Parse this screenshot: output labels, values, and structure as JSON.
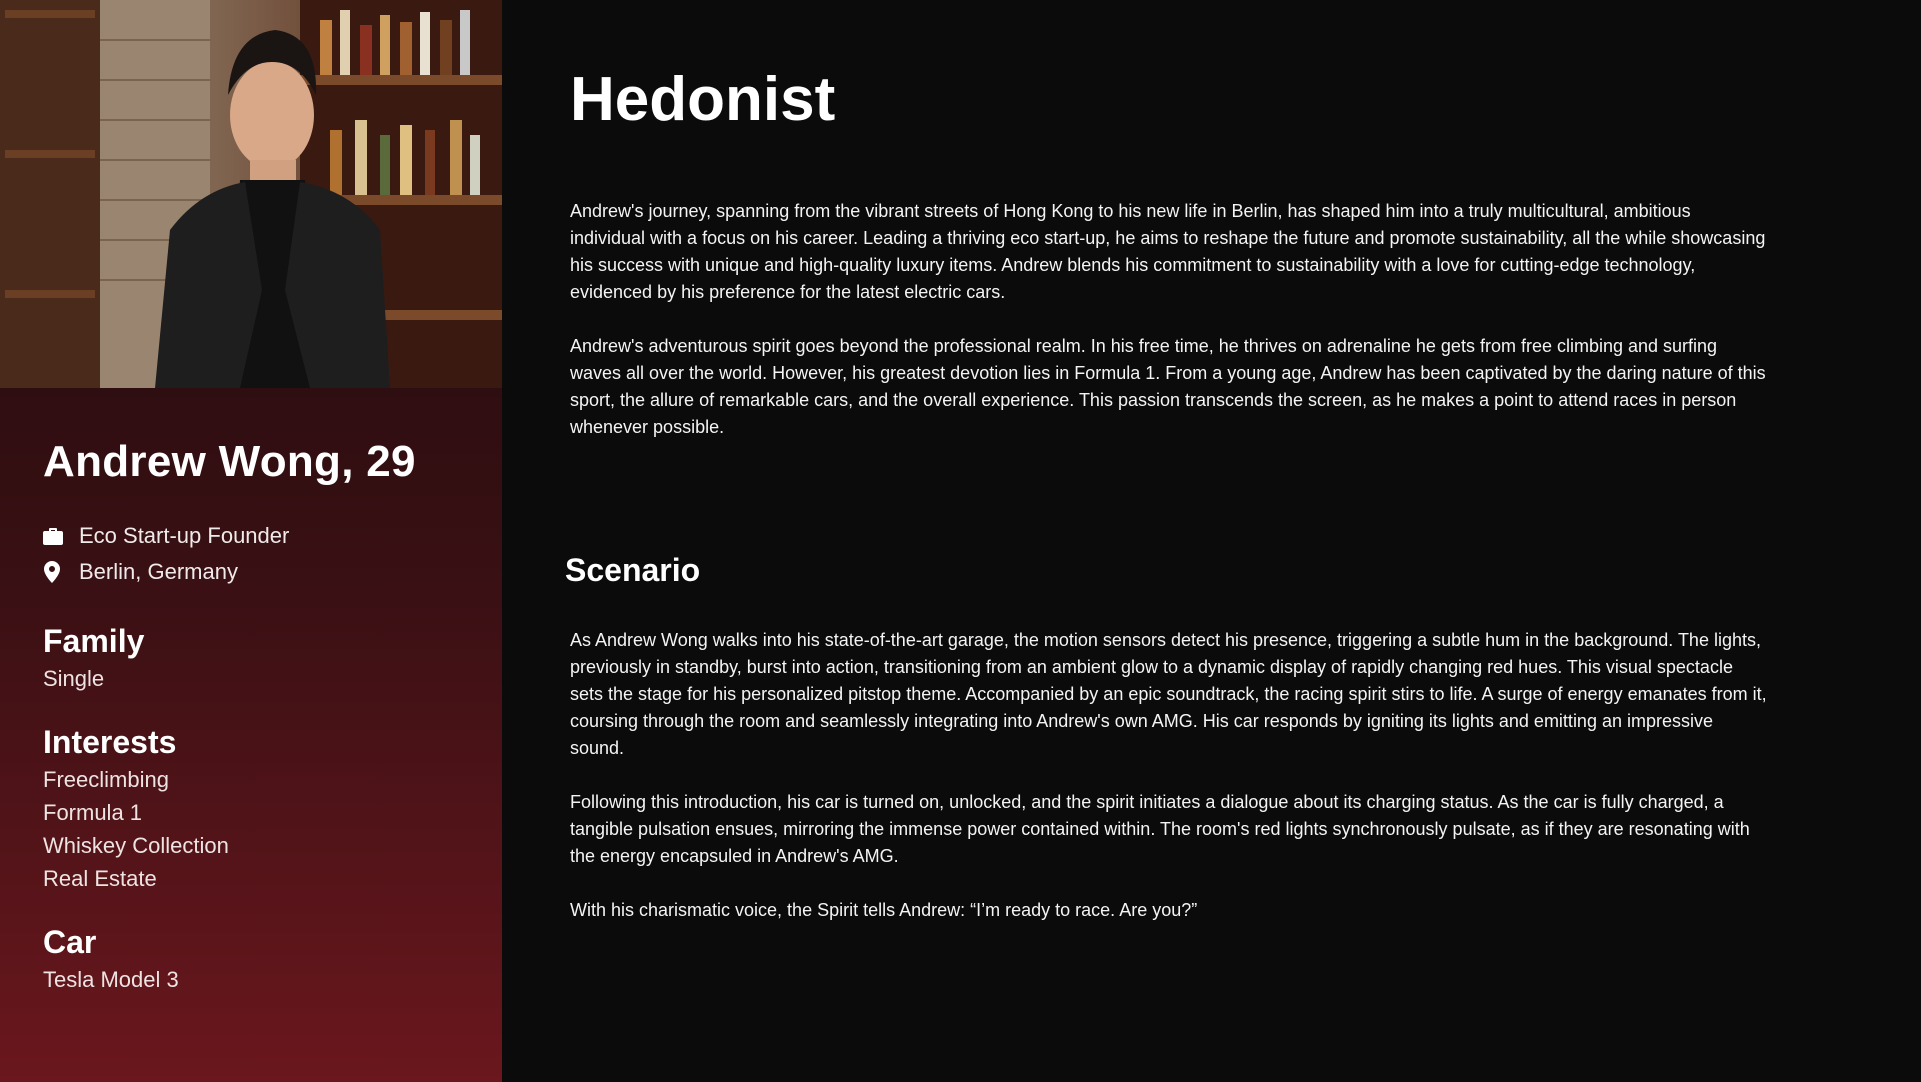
{
  "profile": {
    "name": "Andrew Wong, 29",
    "occupation": "Eco Start-up Founder",
    "location": "Berlin, Germany",
    "family": {
      "title": "Family",
      "value": "Single"
    },
    "interests": {
      "title": "Interests",
      "items": [
        "Freeclimbing",
        "Formula 1",
        "Whiskey Collection",
        "Real Estate"
      ]
    },
    "car": {
      "title": "Car",
      "value": "Tesla Model 3"
    }
  },
  "main": {
    "title": "Hedonist",
    "paragraphs": [
      "Andrew's journey, spanning from the vibrant streets of Hong Kong to his new life in Berlin, has shaped him into a truly multicultural, ambitious individual with a focus on his career. Leading a thriving eco start-up, he aims to reshape the future and promote sustainability, all the while showcasing his success with unique and high-quality luxury items. Andrew blends his commitment to sustainability with a love for cutting-edge technology, evidenced by his preference for the latest electric cars.",
      "Andrew's adventurous spirit goes beyond the professional realm. In his free time, he thrives on adrenaline he gets from free climbing and surfing waves all over the world. However, his greatest devotion lies in Formula 1. From a young age, Andrew has been captivated by the daring nature of this sport, the allure of remarkable cars, and the overall experience. This passion transcends the screen, as he makes a point to attend races in person whenever possible."
    ]
  },
  "scenario": {
    "title": "Scenario",
    "paragraphs": [
      "As Andrew Wong walks into his state-of-the-art garage, the motion sensors detect his presence, triggering a subtle hum in the background. The lights, previously in standby, burst into action, transitioning from an ambient glow to a dynamic display of rapidly changing red hues. This visual spectacle sets the stage for his personalized pitstop theme. Accompanied by an epic soundtrack, the racing spirit stirs to life. A surge of energy emanates from it, coursing through the room and seamlessly integrating into Andrew's own AMG. His car responds by igniting its lights and emitting an impressive sound.",
      "Following this introduction, his car is turned on, unlocked, and the spirit initiates a dialogue about its charging status. As the car is fully charged, a tangible pulsation ensues, mirroring the immense power contained within. The room's red lights synchronously pulsate, as if they are resonating with the energy encapsuled in Andrew's AMG.",
      "With his charismatic voice, the Spirit tells Andrew: “I’m ready to race. Are you?”"
    ]
  },
  "icons": {
    "occupation": "briefcase-icon",
    "location": "map-pin-icon"
  },
  "colors": {
    "background": "#0b0b0b",
    "sidebar_top": "#1a0a0b",
    "sidebar_bottom": "#6a171d"
  }
}
